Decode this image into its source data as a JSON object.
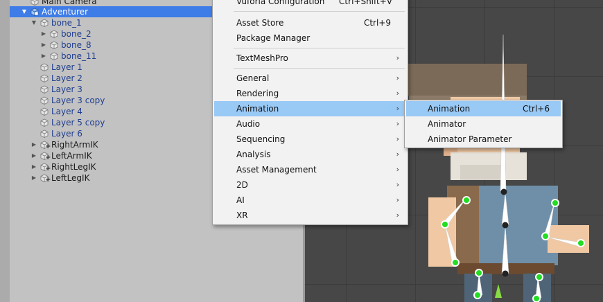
{
  "hierarchy": {
    "items": [
      {
        "label": "Main Camera",
        "prefab": false,
        "selected": false
      },
      {
        "label": "Adventurer",
        "prefab": true,
        "selected": true
      },
      {
        "label": "bone_1",
        "prefab": true,
        "selected": false
      },
      {
        "label": "bone_2",
        "prefab": true,
        "selected": false
      },
      {
        "label": "bone_8",
        "prefab": true,
        "selected": false
      },
      {
        "label": "bone_11",
        "prefab": true,
        "selected": false
      },
      {
        "label": "Layer 1",
        "prefab": true,
        "selected": false
      },
      {
        "label": "Layer 2",
        "prefab": true,
        "selected": false
      },
      {
        "label": "Layer 3",
        "prefab": true,
        "selected": false
      },
      {
        "label": "Layer 3 copy",
        "prefab": true,
        "selected": false
      },
      {
        "label": "Layer 4",
        "prefab": true,
        "selected": false
      },
      {
        "label": "Layer 5 copy",
        "prefab": true,
        "selected": false
      },
      {
        "label": "Layer 6",
        "prefab": true,
        "selected": false
      },
      {
        "label": "RightArmIK",
        "prefab": false,
        "selected": false
      },
      {
        "label": "LeftArmIK",
        "prefab": false,
        "selected": false
      },
      {
        "label": "RightLegIK",
        "prefab": false,
        "selected": false
      },
      {
        "label": "LeftLegIK",
        "prefab": false,
        "selected": false
      }
    ]
  },
  "window_menu": {
    "items": [
      {
        "label": "Vuforia Configuration",
        "shortcut": "Ctrl+Shift+V"
      },
      {
        "label": "Asset Store",
        "shortcut": "Ctrl+9"
      },
      {
        "label": "Package Manager",
        "shortcut": ""
      },
      {
        "label": "TextMeshPro",
        "submenu": true
      },
      {
        "label": "General",
        "submenu": true
      },
      {
        "label": "Rendering",
        "submenu": true
      },
      {
        "label": "Animation",
        "submenu": true,
        "highlighted": true
      },
      {
        "label": "Audio",
        "submenu": true
      },
      {
        "label": "Sequencing",
        "submenu": true
      },
      {
        "label": "Analysis",
        "submenu": true
      },
      {
        "label": "Asset Management",
        "submenu": true
      },
      {
        "label": "2D",
        "submenu": true
      },
      {
        "label": "AI",
        "submenu": true
      },
      {
        "label": "XR",
        "submenu": true
      }
    ]
  },
  "animation_submenu": {
    "items": [
      {
        "label": "Animation",
        "shortcut": "Ctrl+6",
        "highlighted": true
      },
      {
        "label": "Animator",
        "shortcut": ""
      },
      {
        "label": "Animator Parameter",
        "shortcut": ""
      }
    ]
  },
  "icons": {
    "arrow_right": "▶",
    "arrow_down": "▼",
    "submenu_arrow": "›"
  },
  "colors": {
    "selection": "#3e7ce8",
    "menu_highlight": "#99c9f5",
    "bone_joint": "#22dd22",
    "prefab_text": "#1e3d8f"
  }
}
